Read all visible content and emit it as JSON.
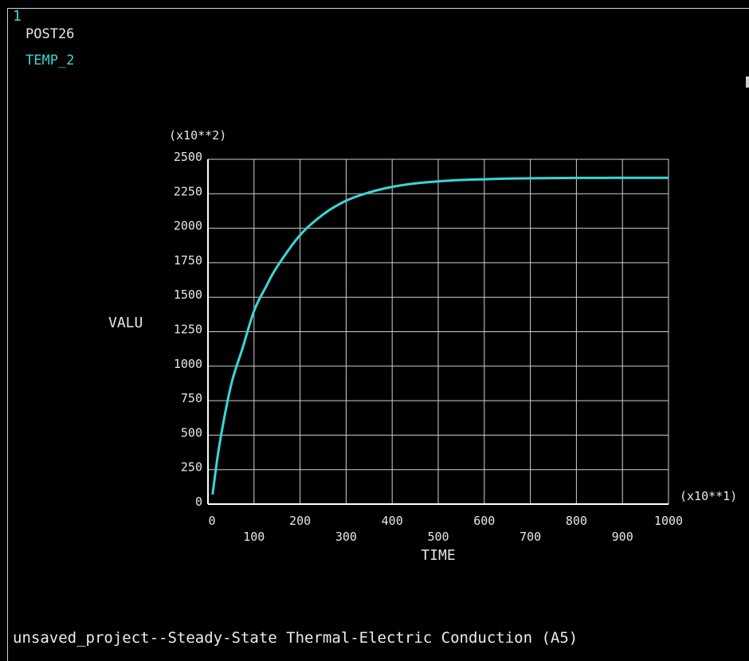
{
  "header": {
    "window_number": "1",
    "module": "POST26",
    "series_label": "TEMP_2"
  },
  "footer": {
    "title": "unsaved_project--Steady-State Thermal-Electric Conduction (A5)"
  },
  "colors": {
    "background": "#000000",
    "axis": "#ffffff",
    "grid": "#cfcfcf",
    "curve": "#3ad6d6",
    "text": "#e6e6e6"
  },
  "chart_data": {
    "type": "line",
    "title": "",
    "xlabel": "TIME",
    "ylabel": "VALU",
    "x_multiplier": "(x10**1)",
    "y_multiplier": "(x10**2)",
    "xlim": [
      0,
      1000
    ],
    "ylim": [
      0,
      2500
    ],
    "x_ticks": [
      0,
      100,
      200,
      300,
      400,
      500,
      600,
      700,
      800,
      900,
      1000
    ],
    "y_ticks": [
      0,
      250,
      500,
      750,
      1000,
      1250,
      1500,
      1750,
      2000,
      2250,
      2500
    ],
    "grid": true,
    "series": [
      {
        "color": "#3ad6d6",
        "x": [
          10,
          25,
          50,
          75,
          100,
          125,
          150,
          200,
          250,
          300,
          350,
          400,
          450,
          500,
          550,
          600,
          650,
          700,
          750,
          800,
          850,
          900,
          950,
          1000
        ],
        "y": [
          70,
          430,
          860,
          1130,
          1400,
          1570,
          1720,
          1950,
          2100,
          2200,
          2260,
          2300,
          2325,
          2340,
          2350,
          2355,
          2360,
          2362,
          2364,
          2365,
          2365,
          2366,
          2366,
          2366
        ]
      }
    ]
  }
}
